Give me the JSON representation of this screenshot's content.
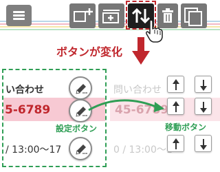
{
  "toolbar": {
    "menu_icon": "hamburger-icon",
    "buttons": [
      {
        "name": "add-item-button",
        "icon": "add-row-icon"
      },
      {
        "name": "insert-item-button",
        "icon": "insert-row-icon"
      },
      {
        "name": "reorder-toggle-button",
        "icon": "up-down-arrows-icon",
        "active": true
      },
      {
        "name": "delete-button",
        "icon": "trash-icon"
      },
      {
        "name": "copy-button",
        "icon": "copy-icon"
      }
    ]
  },
  "annotation": {
    "change_caption": "ボタンが変化",
    "settings_caption": "設定ボタン",
    "move_caption": "移動ボタン"
  },
  "left_panel": {
    "row1": "い合わせ",
    "row2": "5-6789",
    "row3": "/ 13:00〜17"
  },
  "right_panel": {
    "row1": "問い合わせ",
    "row2": "45-6789",
    "row3": "0 / 13:00〜1"
  },
  "colors": {
    "accent_red": "#c0272d",
    "accent_green": "#2f9e55",
    "toolbar_gray": "#777777",
    "pink": "#f7c9d3"
  }
}
